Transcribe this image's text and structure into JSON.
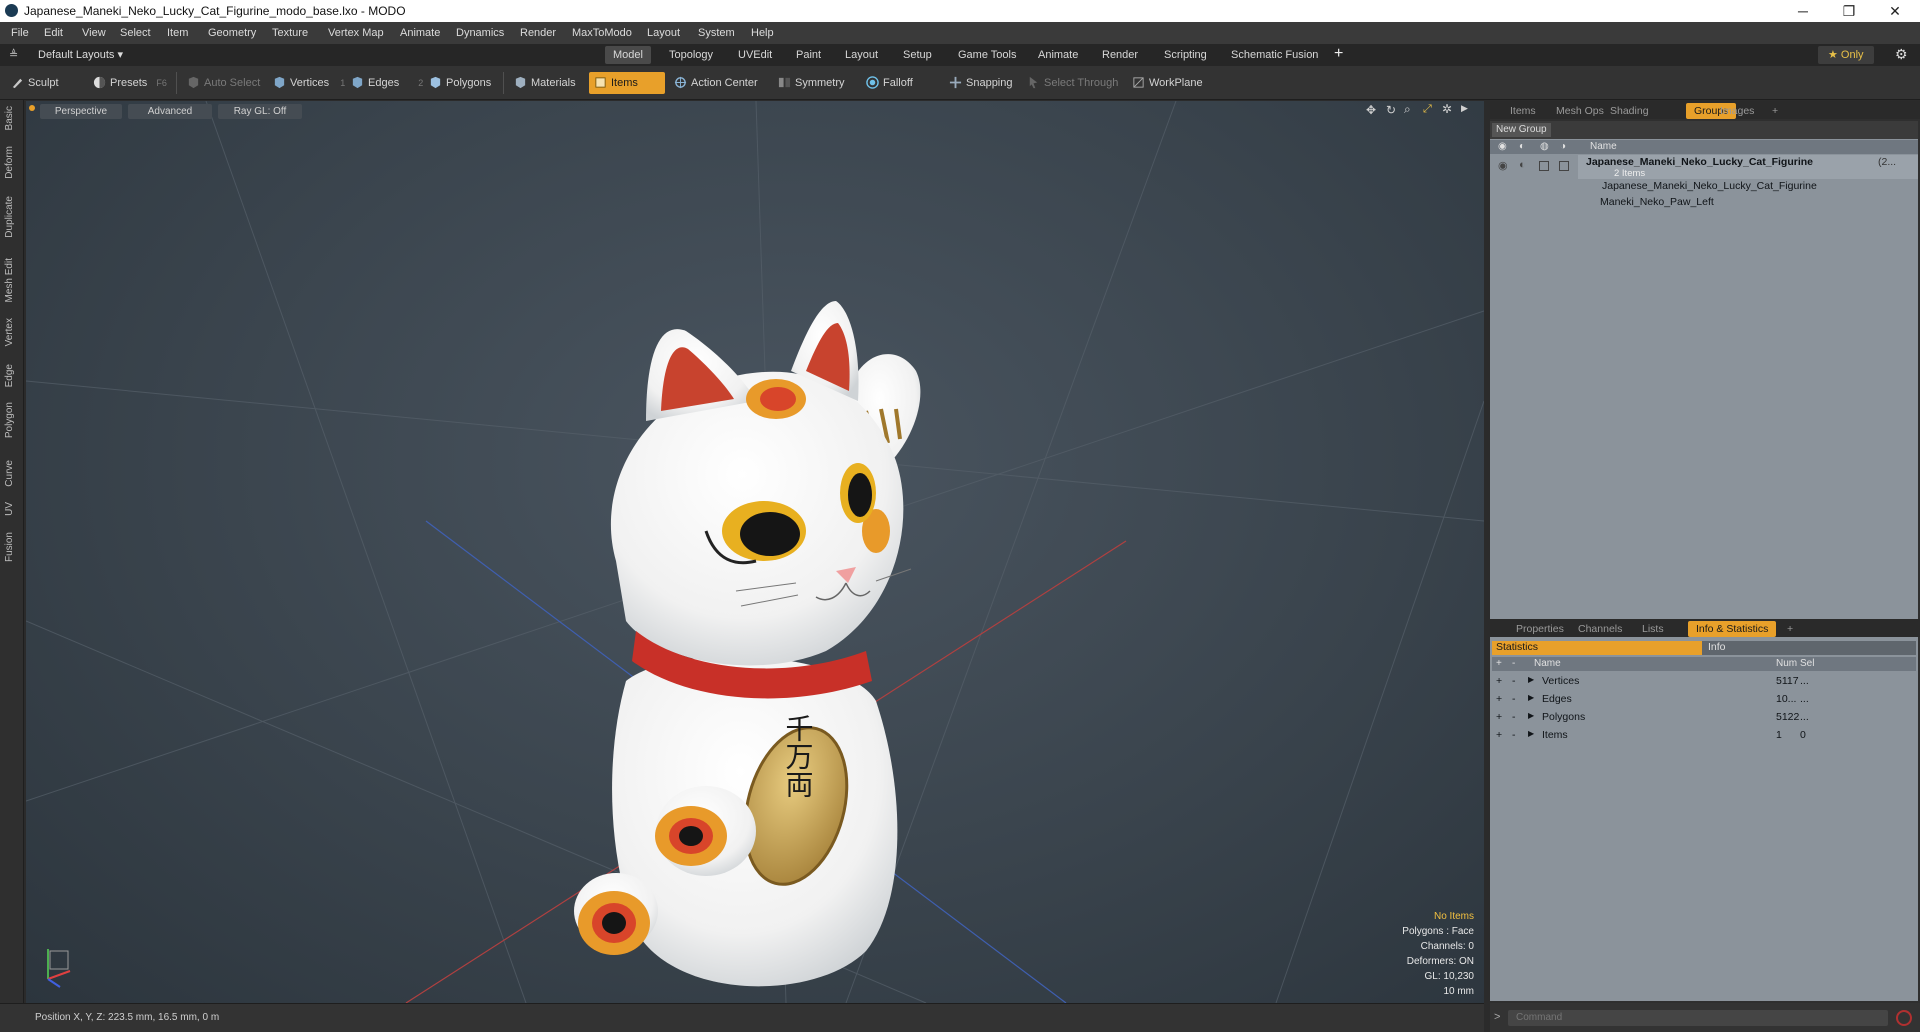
{
  "window": {
    "title": "Japanese_Maneki_Neko_Lucky_Cat_Figurine_modo_base.lxo - MODO",
    "controls": [
      "─",
      "❐",
      "✕"
    ]
  },
  "menu": [
    "File",
    "Edit",
    "View",
    "Select",
    "Item",
    "Geometry",
    "Texture",
    "Vertex Map",
    "Animate",
    "Dynamics",
    "Render",
    "MaxToModo",
    "Layout",
    "System",
    "Help"
  ],
  "layoutbar": {
    "default_layouts": "Default Layouts ▾",
    "tabs": [
      "Model",
      "Topology",
      "UVEdit",
      "Paint",
      "Layout",
      "Setup",
      "Game Tools",
      "Animate",
      "Render",
      "Scripting",
      "Schematic Fusion"
    ],
    "active_tab": "Model",
    "add": "+",
    "only": "★  Only"
  },
  "toolbar": {
    "sculpt": "Sculpt",
    "presets": "Presets",
    "presets_key": "F6",
    "auto_select": "Auto Select",
    "vertices": "Vertices",
    "vertices_count": "1",
    "edges": "Edges",
    "edges_count": "2",
    "polygons": "Polygons",
    "materials": "Materials",
    "items": "Items",
    "action_center": "Action Center",
    "symmetry": "Symmetry",
    "falloff": "Falloff",
    "snapping": "Snapping",
    "select_through": "Select Through",
    "workplane": "WorkPlane"
  },
  "lefttabs": [
    "Basic",
    "Deform",
    "Duplicate",
    "Mesh Edit",
    "Vertex",
    "Edge",
    "Polygon",
    "Curve",
    "UV",
    "Fusion"
  ],
  "viewport": {
    "perspective": "Perspective",
    "advanced": "Advanced",
    "raygl": "Ray GL: Off",
    "overlay": {
      "no_items": "No Items",
      "polygons": "Polygons : Face",
      "channels": "Channels: 0",
      "deformers": "Deformers: ON",
      "gl": "GL: 10,230",
      "scale": "10 mm"
    },
    "coin_text": "千万両"
  },
  "groups_panel": {
    "tabs": [
      "Items",
      "Mesh Ops",
      "Shading",
      "Groups",
      "Images",
      "+"
    ],
    "active_tab": "Groups",
    "new_group": "New Group",
    "col_name": "Name",
    "group_name": "Japanese_Maneki_Neko_Lucky_Cat_Figurine",
    "group_suffix": "(2...",
    "group_count": "2 Items",
    "children": [
      "Japanese_Maneki_Neko_Lucky_Cat_Figurine",
      "Maneki_Neko_Paw_Left"
    ]
  },
  "stats_panel": {
    "tabs": [
      "Properties",
      "Channels",
      "Lists",
      "Info & Statistics",
      "+"
    ],
    "active_tab": "Info & Statistics",
    "sub_statistics": "Statistics",
    "sub_info": "Info",
    "col_name": "Name",
    "col_num": "Num",
    "col_sel": "Sel",
    "rows": [
      {
        "name": "Vertices",
        "num": "5117",
        "sel": "..."
      },
      {
        "name": "Edges",
        "num": "10...",
        "sel": "..."
      },
      {
        "name": "Polygons",
        "num": "5122",
        "sel": "..."
      },
      {
        "name": "Items",
        "num": "1",
        "sel": "0"
      }
    ]
  },
  "status": {
    "position": "Position X, Y, Z:   223.5 mm, 16.5 mm, 0 m",
    "command_prompt": ">",
    "command_placeholder": "Command"
  }
}
